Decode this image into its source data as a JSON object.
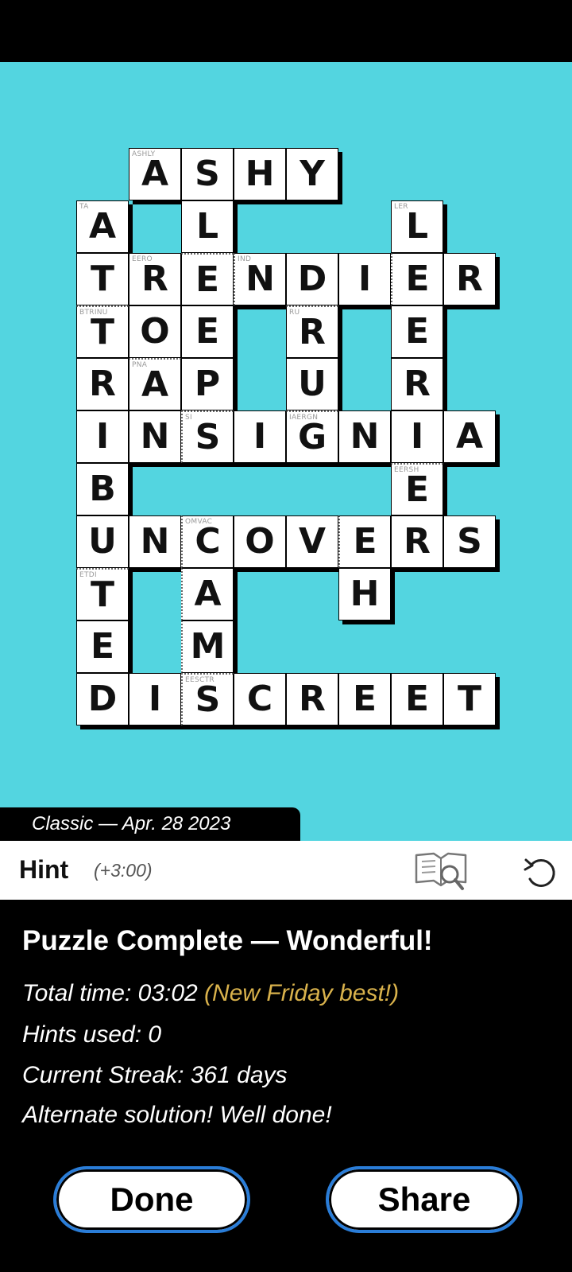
{
  "puzzle_label": "Classic — Apr. 28 2023",
  "toolbar": {
    "hint_label": "Hint",
    "hint_cost": "(+3:00)",
    "lookup_icon": "book-magnifier-icon",
    "undo_icon": "undo-icon"
  },
  "grid": {
    "cells": [
      {
        "r": 0,
        "c": 1,
        "letter": "A",
        "clue": "ASHLY"
      },
      {
        "r": 0,
        "c": 2,
        "letter": "S"
      },
      {
        "r": 0,
        "c": 3,
        "letter": "H"
      },
      {
        "r": 0,
        "c": 4,
        "letter": "Y"
      },
      {
        "r": 1,
        "c": 0,
        "letter": "A",
        "clue": "TA"
      },
      {
        "r": 1,
        "c": 2,
        "letter": "L"
      },
      {
        "r": 1,
        "c": 6,
        "letter": "L",
        "clue": "LER"
      },
      {
        "r": 2,
        "c": 0,
        "letter": "T"
      },
      {
        "r": 2,
        "c": 1,
        "letter": "R",
        "clue": "EERO"
      },
      {
        "r": 2,
        "c": 2,
        "letter": "E",
        "dt": true
      },
      {
        "r": 2,
        "c": 3,
        "letter": "N",
        "clue": "IND",
        "dl": true
      },
      {
        "r": 2,
        "c": 4,
        "letter": "D"
      },
      {
        "r": 2,
        "c": 5,
        "letter": "I"
      },
      {
        "r": 2,
        "c": 6,
        "letter": "E",
        "dl": true
      },
      {
        "r": 2,
        "c": 7,
        "letter": "R"
      },
      {
        "r": 3,
        "c": 0,
        "letter": "T",
        "clue": "BTRINU",
        "dt": true
      },
      {
        "r": 3,
        "c": 1,
        "letter": "O"
      },
      {
        "r": 3,
        "c": 2,
        "letter": "E"
      },
      {
        "r": 3,
        "c": 4,
        "letter": "R",
        "clue": "RU",
        "dt": true
      },
      {
        "r": 3,
        "c": 6,
        "letter": "E"
      },
      {
        "r": 4,
        "c": 0,
        "letter": "R"
      },
      {
        "r": 4,
        "c": 1,
        "letter": "A",
        "clue": "PNA",
        "dt": true
      },
      {
        "r": 4,
        "c": 2,
        "letter": "P"
      },
      {
        "r": 4,
        "c": 4,
        "letter": "U"
      },
      {
        "r": 4,
        "c": 6,
        "letter": "R"
      },
      {
        "r": 5,
        "c": 0,
        "letter": "I"
      },
      {
        "r": 5,
        "c": 1,
        "letter": "N"
      },
      {
        "r": 5,
        "c": 2,
        "letter": "S",
        "clue": "SI",
        "dl": true,
        "dt": true
      },
      {
        "r": 5,
        "c": 3,
        "letter": "I"
      },
      {
        "r": 5,
        "c": 4,
        "letter": "G",
        "clue": "IAERGN",
        "dt": true
      },
      {
        "r": 5,
        "c": 5,
        "letter": "N"
      },
      {
        "r": 5,
        "c": 6,
        "letter": "I"
      },
      {
        "r": 5,
        "c": 7,
        "letter": "A"
      },
      {
        "r": 6,
        "c": 0,
        "letter": "B"
      },
      {
        "r": 6,
        "c": 6,
        "letter": "E",
        "clue": "EERSH",
        "dt": true
      },
      {
        "r": 7,
        "c": 0,
        "letter": "U"
      },
      {
        "r": 7,
        "c": 1,
        "letter": "N"
      },
      {
        "r": 7,
        "c": 2,
        "letter": "C",
        "clue": "OMVAC",
        "dl": true
      },
      {
        "r": 7,
        "c": 3,
        "letter": "O"
      },
      {
        "r": 7,
        "c": 4,
        "letter": "V"
      },
      {
        "r": 7,
        "c": 5,
        "letter": "E",
        "dl": true
      },
      {
        "r": 7,
        "c": 6,
        "letter": "R"
      },
      {
        "r": 7,
        "c": 7,
        "letter": "S"
      },
      {
        "r": 8,
        "c": 0,
        "letter": "T",
        "clue": "ETDI",
        "dt": true
      },
      {
        "r": 8,
        "c": 2,
        "letter": "A",
        "dl": true
      },
      {
        "r": 8,
        "c": 5,
        "letter": "H"
      },
      {
        "r": 9,
        "c": 0,
        "letter": "E"
      },
      {
        "r": 9,
        "c": 2,
        "letter": "M",
        "dl": true
      },
      {
        "r": 10,
        "c": 0,
        "letter": "D"
      },
      {
        "r": 10,
        "c": 1,
        "letter": "I"
      },
      {
        "r": 10,
        "c": 2,
        "letter": "S",
        "clue": "EESCTR",
        "dl": true,
        "dt": true
      },
      {
        "r": 10,
        "c": 3,
        "letter": "C"
      },
      {
        "r": 10,
        "c": 4,
        "letter": "R"
      },
      {
        "r": 10,
        "c": 5,
        "letter": "E"
      },
      {
        "r": 10,
        "c": 6,
        "letter": "E"
      },
      {
        "r": 10,
        "c": 7,
        "letter": "T"
      }
    ]
  },
  "results": {
    "title": "Puzzle Complete — Wonderful!",
    "total_time": "Total time: 03:02",
    "new_best": "(New Friday best!)",
    "hints_used": "Hints used: 0",
    "streak": "Current Streak: 361 days",
    "alternate": "Alternate solution! Well done!"
  },
  "buttons": {
    "done": "Done",
    "share": "Share"
  },
  "colors": {
    "board_bg": "#53d5e0",
    "highlight": "#d9b24c",
    "button_border": "#2a7dd8"
  }
}
